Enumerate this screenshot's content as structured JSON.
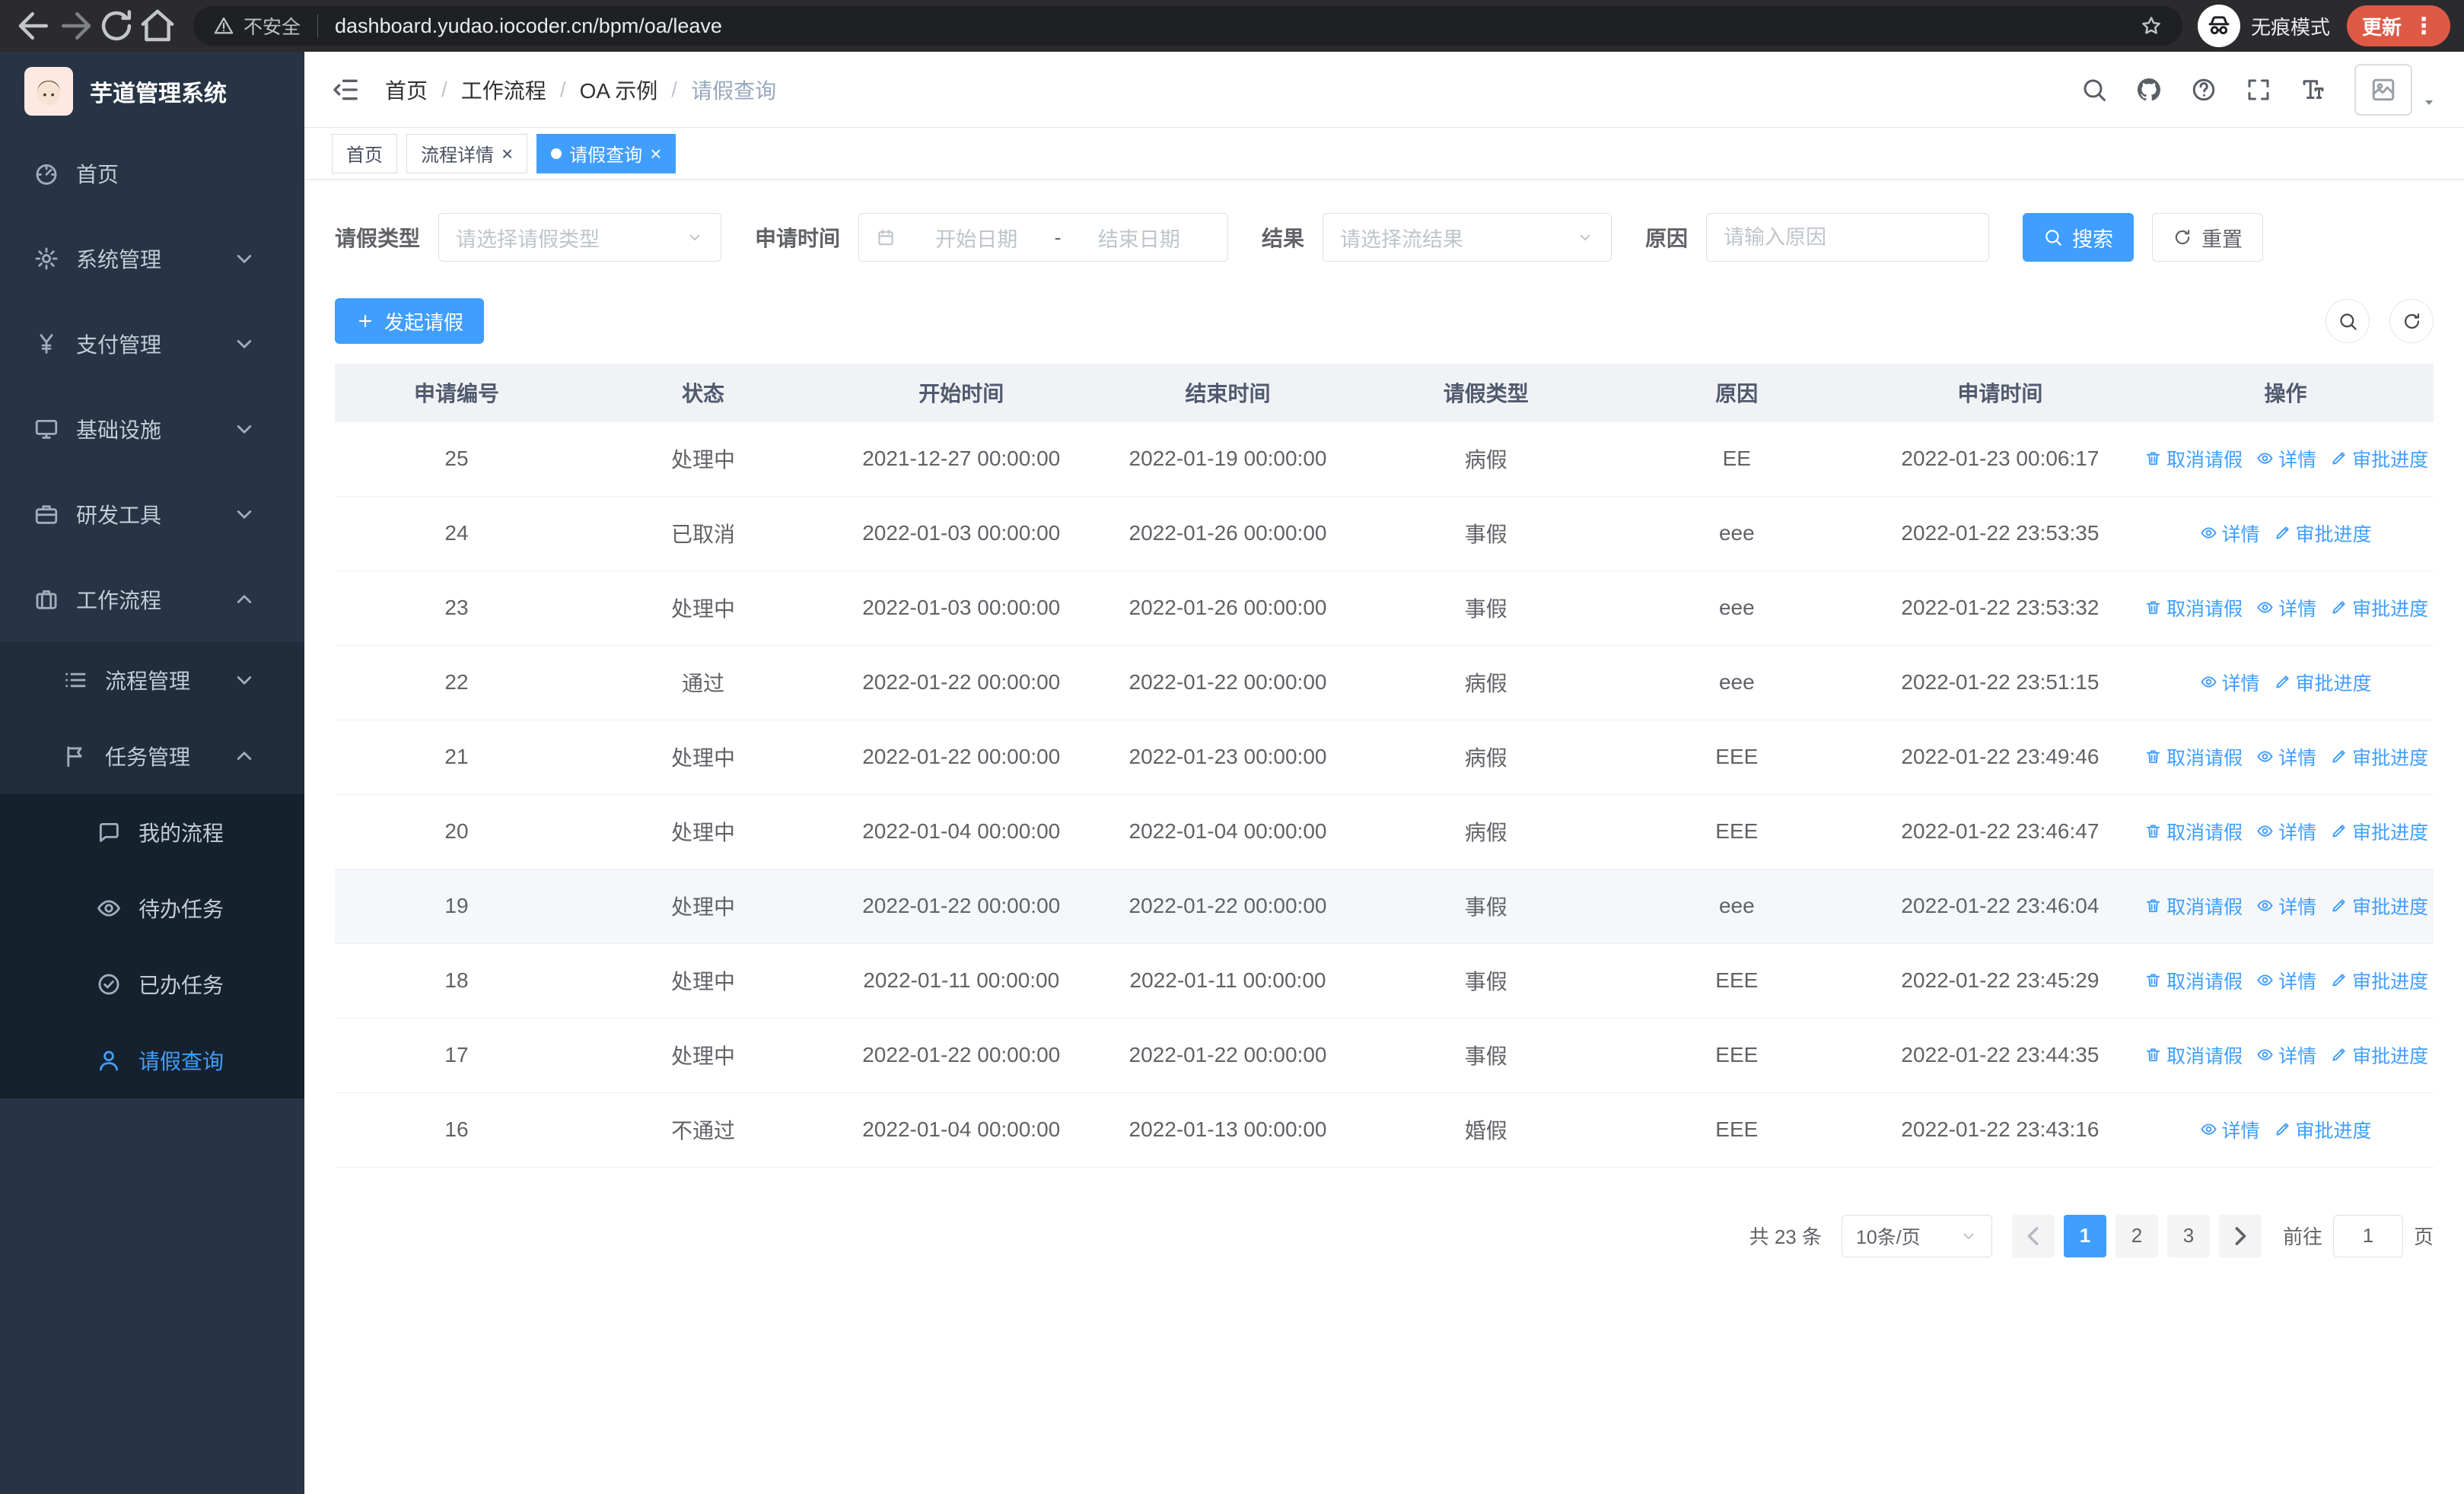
{
  "browser": {
    "security_warning": "不安全",
    "url": "dashboard.yudao.iocoder.cn/bpm/oa/leave",
    "incognito_label": "无痕模式",
    "update_button": "更新"
  },
  "sidebar": {
    "logo_title": "芋道管理系统",
    "menu": [
      {
        "label": "首页",
        "icon": "dashboard",
        "level": 0
      },
      {
        "label": "系统管理",
        "icon": "gear",
        "level": 0,
        "chevron": "down"
      },
      {
        "label": "支付管理",
        "icon": "yen",
        "level": 0,
        "chevron": "down"
      },
      {
        "label": "基础设施",
        "icon": "monitor",
        "level": 0,
        "chevron": "down"
      },
      {
        "label": "研发工具",
        "icon": "briefcase",
        "level": 0,
        "chevron": "down"
      },
      {
        "label": "工作流程",
        "icon": "suitcase",
        "level": 0,
        "chevron": "up"
      },
      {
        "label": "流程管理",
        "icon": "list",
        "level": 1,
        "chevron": "down"
      },
      {
        "label": "任务管理",
        "icon": "flag",
        "level": 1,
        "chevron": "up"
      },
      {
        "label": "我的流程",
        "icon": "chat",
        "level": 2
      },
      {
        "label": "待办任务",
        "icon": "eye",
        "level": 2
      },
      {
        "label": "已办任务",
        "icon": "check",
        "level": 2
      },
      {
        "label": "请假查询",
        "icon": "person",
        "level": 2,
        "active": true
      }
    ]
  },
  "header": {
    "breadcrumb": [
      "首页",
      "工作流程",
      "OA 示例",
      "请假查询"
    ]
  },
  "tabs": [
    {
      "label": "首页",
      "closable": false,
      "active": false
    },
    {
      "label": "流程详情",
      "closable": true,
      "active": false
    },
    {
      "label": "请假查询",
      "closable": true,
      "active": true
    }
  ],
  "filters": {
    "leave_type_label": "请假类型",
    "leave_type_placeholder": "请选择请假类型",
    "apply_time_label": "申请时间",
    "start_date_placeholder": "开始日期",
    "range_separator": "-",
    "end_date_placeholder": "结束日期",
    "result_label": "结果",
    "result_placeholder": "请选择流结果",
    "reason_label": "原因",
    "reason_placeholder": "请输入原因",
    "search_button": "搜索",
    "reset_button": "重置"
  },
  "toolbar": {
    "create_button": "发起请假"
  },
  "table": {
    "columns": [
      "申请编号",
      "状态",
      "开始时间",
      "结束时间",
      "请假类型",
      "原因",
      "申请时间",
      "操作"
    ],
    "action_labels": {
      "cancel": "取消请假",
      "detail": "详情",
      "progress": "审批进度"
    },
    "rows": [
      {
        "id": "25",
        "status": "处理中",
        "start": "2021-12-27 00:00:00",
        "end": "2022-01-19 00:00:00",
        "type": "病假",
        "reason": "EE",
        "apply_time": "2022-01-23 00:06:17",
        "actions": [
          "cancel",
          "detail",
          "progress"
        ]
      },
      {
        "id": "24",
        "status": "已取消",
        "start": "2022-01-03 00:00:00",
        "end": "2022-01-26 00:00:00",
        "type": "事假",
        "reason": "eee",
        "apply_time": "2022-01-22 23:53:35",
        "actions": [
          "detail",
          "progress"
        ]
      },
      {
        "id": "23",
        "status": "处理中",
        "start": "2022-01-03 00:00:00",
        "end": "2022-01-26 00:00:00",
        "type": "事假",
        "reason": "eee",
        "apply_time": "2022-01-22 23:53:32",
        "actions": [
          "cancel",
          "detail",
          "progress"
        ]
      },
      {
        "id": "22",
        "status": "通过",
        "start": "2022-01-22 00:00:00",
        "end": "2022-01-22 00:00:00",
        "type": "病假",
        "reason": "eee",
        "apply_time": "2022-01-22 23:51:15",
        "actions": [
          "detail",
          "progress"
        ]
      },
      {
        "id": "21",
        "status": "处理中",
        "start": "2022-01-22 00:00:00",
        "end": "2022-01-23 00:00:00",
        "type": "病假",
        "reason": "EEE",
        "apply_time": "2022-01-22 23:49:46",
        "actions": [
          "cancel",
          "detail",
          "progress"
        ]
      },
      {
        "id": "20",
        "status": "处理中",
        "start": "2022-01-04 00:00:00",
        "end": "2022-01-04 00:00:00",
        "type": "病假",
        "reason": "EEE",
        "apply_time": "2022-01-22 23:46:47",
        "actions": [
          "cancel",
          "detail",
          "progress"
        ]
      },
      {
        "id": "19",
        "status": "处理中",
        "start": "2022-01-22 00:00:00",
        "end": "2022-01-22 00:00:00",
        "type": "事假",
        "reason": "eee",
        "apply_time": "2022-01-22 23:46:04",
        "actions": [
          "cancel",
          "detail",
          "progress"
        ],
        "highlight": true
      },
      {
        "id": "18",
        "status": "处理中",
        "start": "2022-01-11 00:00:00",
        "end": "2022-01-11 00:00:00",
        "type": "事假",
        "reason": "EEE",
        "apply_time": "2022-01-22 23:45:29",
        "actions": [
          "cancel",
          "detail",
          "progress"
        ]
      },
      {
        "id": "17",
        "status": "处理中",
        "start": "2022-01-22 00:00:00",
        "end": "2022-01-22 00:00:00",
        "type": "事假",
        "reason": "EEE",
        "apply_time": "2022-01-22 23:44:35",
        "actions": [
          "cancel",
          "detail",
          "progress"
        ]
      },
      {
        "id": "16",
        "status": "不通过",
        "start": "2022-01-04 00:00:00",
        "end": "2022-01-13 00:00:00",
        "type": "婚假",
        "reason": "EEE",
        "apply_time": "2022-01-22 23:43:16",
        "actions": [
          "detail",
          "progress"
        ]
      }
    ]
  },
  "pagination": {
    "total_text": "共 23 条",
    "page_size": "10条/页",
    "pages": [
      "1",
      "2",
      "3"
    ],
    "active_page": "1",
    "goto_label": "前往",
    "goto_value": "1",
    "goto_suffix": "页"
  }
}
